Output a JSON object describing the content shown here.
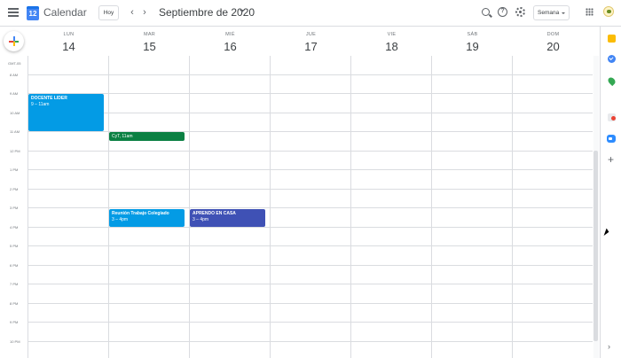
{
  "app": {
    "title": "Calendar",
    "logo_day": "12"
  },
  "toolbar": {
    "today_label": "Hoy",
    "prev_label": "‹",
    "next_label": "›",
    "month_label": "Septiembre de 2020",
    "view_label": "Semana"
  },
  "timezone": "GMT-05",
  "days": [
    {
      "dow": "LUN",
      "num": "14"
    },
    {
      "dow": "MAR",
      "num": "15"
    },
    {
      "dow": "MIÉ",
      "num": "16"
    },
    {
      "dow": "JUE",
      "num": "17"
    },
    {
      "dow": "VIE",
      "num": "18"
    },
    {
      "dow": "SÁB",
      "num": "19"
    },
    {
      "dow": "DOM",
      "num": "20"
    }
  ],
  "hours": [
    "8 AM",
    "9 AM",
    "10 AM",
    "11 AM",
    "12 PM",
    "1 PM",
    "2 PM",
    "3 PM",
    "4 PM",
    "5 PM",
    "6 PM",
    "7 PM",
    "8 PM",
    "9 PM",
    "10 PM"
  ],
  "events": [
    {
      "title": "DOCENTE LIDER",
      "time": "9 – 11am",
      "color": "#039be5"
    },
    {
      "title": "CyT, 11am",
      "time": "",
      "color": "#0b8043"
    },
    {
      "title": "Reunión Trabajo Colegiado",
      "time": "3 – 4pm",
      "color": "#039be5"
    },
    {
      "title": "APRENDO EN CASA",
      "time": "3 – 4pm",
      "color": "#3f51b5"
    }
  ],
  "side_panel": {
    "add_label": "+",
    "expand_label": "›"
  },
  "icons": [
    "menu-icon",
    "calendar-logo-icon",
    "search-icon",
    "help-icon",
    "gear-icon",
    "apps-icon",
    "keep-icon",
    "tasks-icon",
    "maps-icon",
    "contacts-icon",
    "zoom-icon"
  ]
}
